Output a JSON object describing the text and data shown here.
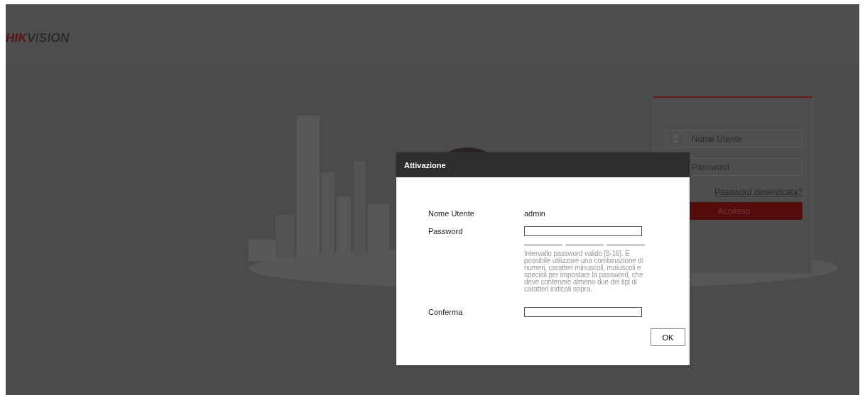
{
  "header": {
    "logo": {
      "bold": "HIK",
      "rest": "VISION"
    }
  },
  "login": {
    "username_field": {
      "placeholder": "Nome Utente"
    },
    "password_field": {
      "placeholder": "Password"
    },
    "forgot_link": "Password dimenticata?",
    "login_button": "Accesso"
  },
  "dialog": {
    "title": "Attivazione",
    "rows": [
      {
        "kind": "value",
        "label": "Nome Utente",
        "value": "admin"
      },
      {
        "kind": "password",
        "label": "Password",
        "hint": "Intervallo password valido [8-16]. È possibile utilizzare una combinazione di numeri, caratteri minuscoli, maiuscoli e speciali per impostare la password, che deve contenere almeno due dei tipi di caratteri indicati sopra."
      },
      {
        "kind": "input",
        "label": "Conferma"
      }
    ],
    "ok_button": "OK"
  }
}
